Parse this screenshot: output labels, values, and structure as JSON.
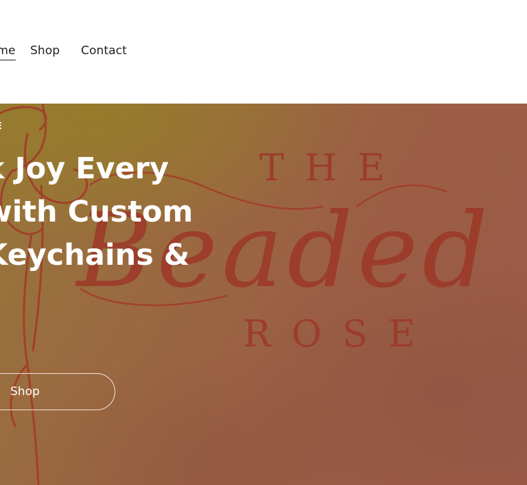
{
  "nav": {
    "items": [
      {
        "label": "Home"
      },
      {
        "label": "Shop"
      },
      {
        "label": "Contact"
      }
    ]
  },
  "hero": {
    "eyebrow": "E",
    "headline_lines": [
      "k Joy Every",
      "with Custom",
      " Keychains &"
    ],
    "button_label": "Shop"
  },
  "logo": {
    "top_word": "THE",
    "script_word": "Beaded",
    "bottom_word": "ROSE",
    "color": "#9c3d2c"
  },
  "colors": {
    "header_bg": "#ffffff",
    "hero_gold": "#977838",
    "hero_rust": "#9a5a48",
    "text_white": "#ffffff"
  }
}
